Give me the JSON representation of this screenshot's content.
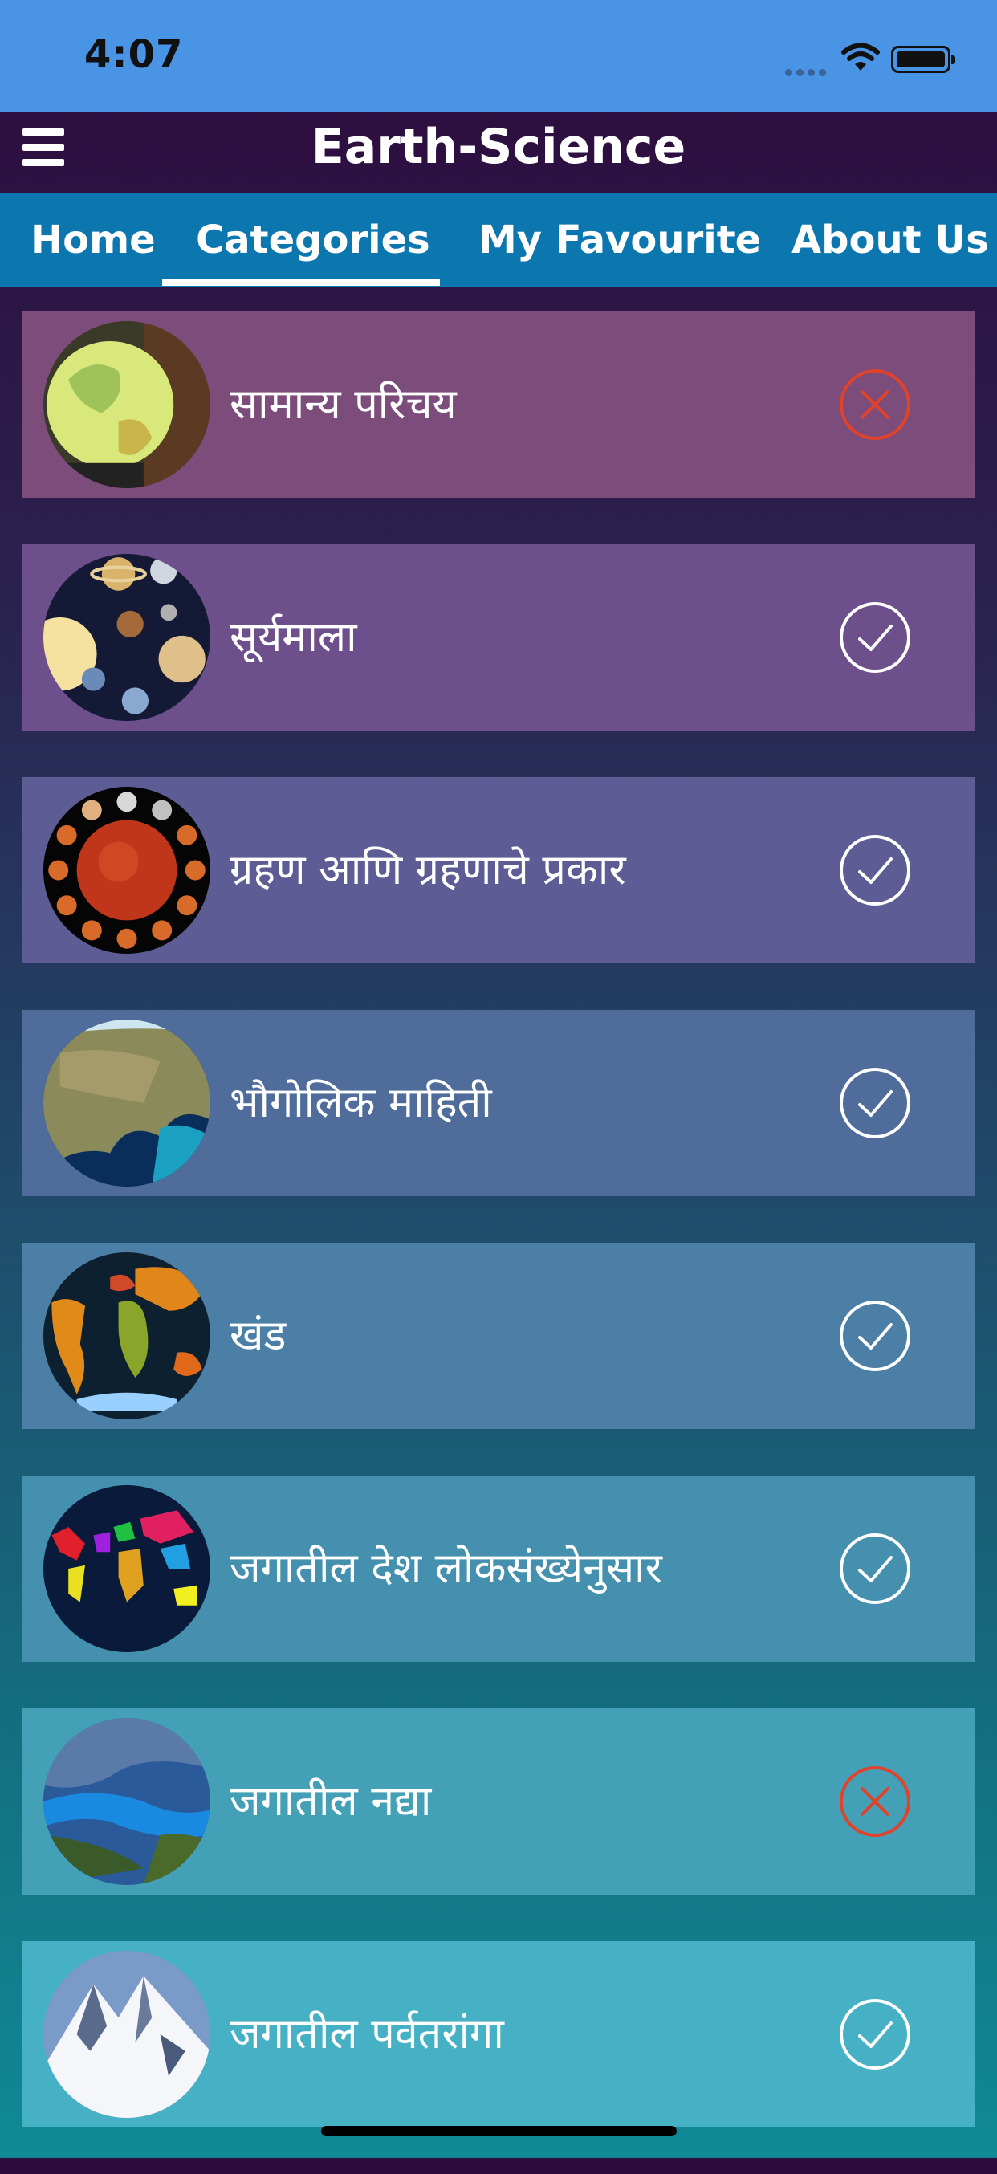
{
  "status_bar": {
    "time": "4:07"
  },
  "header": {
    "title": "Earth-Science",
    "menu_icon": "hamburger-icon"
  },
  "tabs": [
    {
      "label": "Home",
      "selected": false
    },
    {
      "label": "Categories",
      "selected": true
    },
    {
      "label": "My Favourite",
      "selected": false
    },
    {
      "label": "About Us",
      "selected": false
    }
  ],
  "categories": [
    {
      "label": "सामान्य परिचय",
      "status": "locked",
      "status_icon": "x-circle-icon",
      "thumbnail_icon": "globe-icon",
      "row_color": "#7c4c7a"
    },
    {
      "label": "सूर्यमाला",
      "status": "available",
      "status_icon": "check-circle-icon",
      "thumbnail_icon": "solar-system-icon",
      "row_color": "#6d4f8c"
    },
    {
      "label": "ग्रहण आणि ग्रहणाचे प्रकार",
      "status": "available",
      "status_icon": "check-circle-icon",
      "thumbnail_icon": "eclipse-icon",
      "row_color": "#5e5c94"
    },
    {
      "label": "भौगोलिक माहिती",
      "status": "available",
      "status_icon": "check-circle-icon",
      "thumbnail_icon": "earth-satellite-icon",
      "row_color": "#4f6c9a"
    },
    {
      "label": "खंड",
      "status": "available",
      "status_icon": "check-circle-icon",
      "thumbnail_icon": "continents-map-icon",
      "row_color": "#4b7fa6"
    },
    {
      "label": "जगातील देश लोकसंख्येनुसार",
      "status": "available",
      "status_icon": "check-circle-icon",
      "thumbnail_icon": "world-countries-map-icon",
      "row_color": "#4590ae"
    },
    {
      "label": "जगातील नद्या",
      "status": "locked",
      "status_icon": "x-circle-icon",
      "thumbnail_icon": "river-icon",
      "row_color": "#43a0b6"
    },
    {
      "label": "जगातील पर्वतरांगा",
      "status": "available",
      "status_icon": "check-circle-icon",
      "thumbnail_icon": "mountain-icon",
      "row_color": "#46b0c4"
    }
  ],
  "colors": {
    "status_bar": "#4a94e6",
    "tab_bar": "#0c77ae",
    "locked_icon": "#e2422a",
    "available_icon": "#ffffff"
  }
}
